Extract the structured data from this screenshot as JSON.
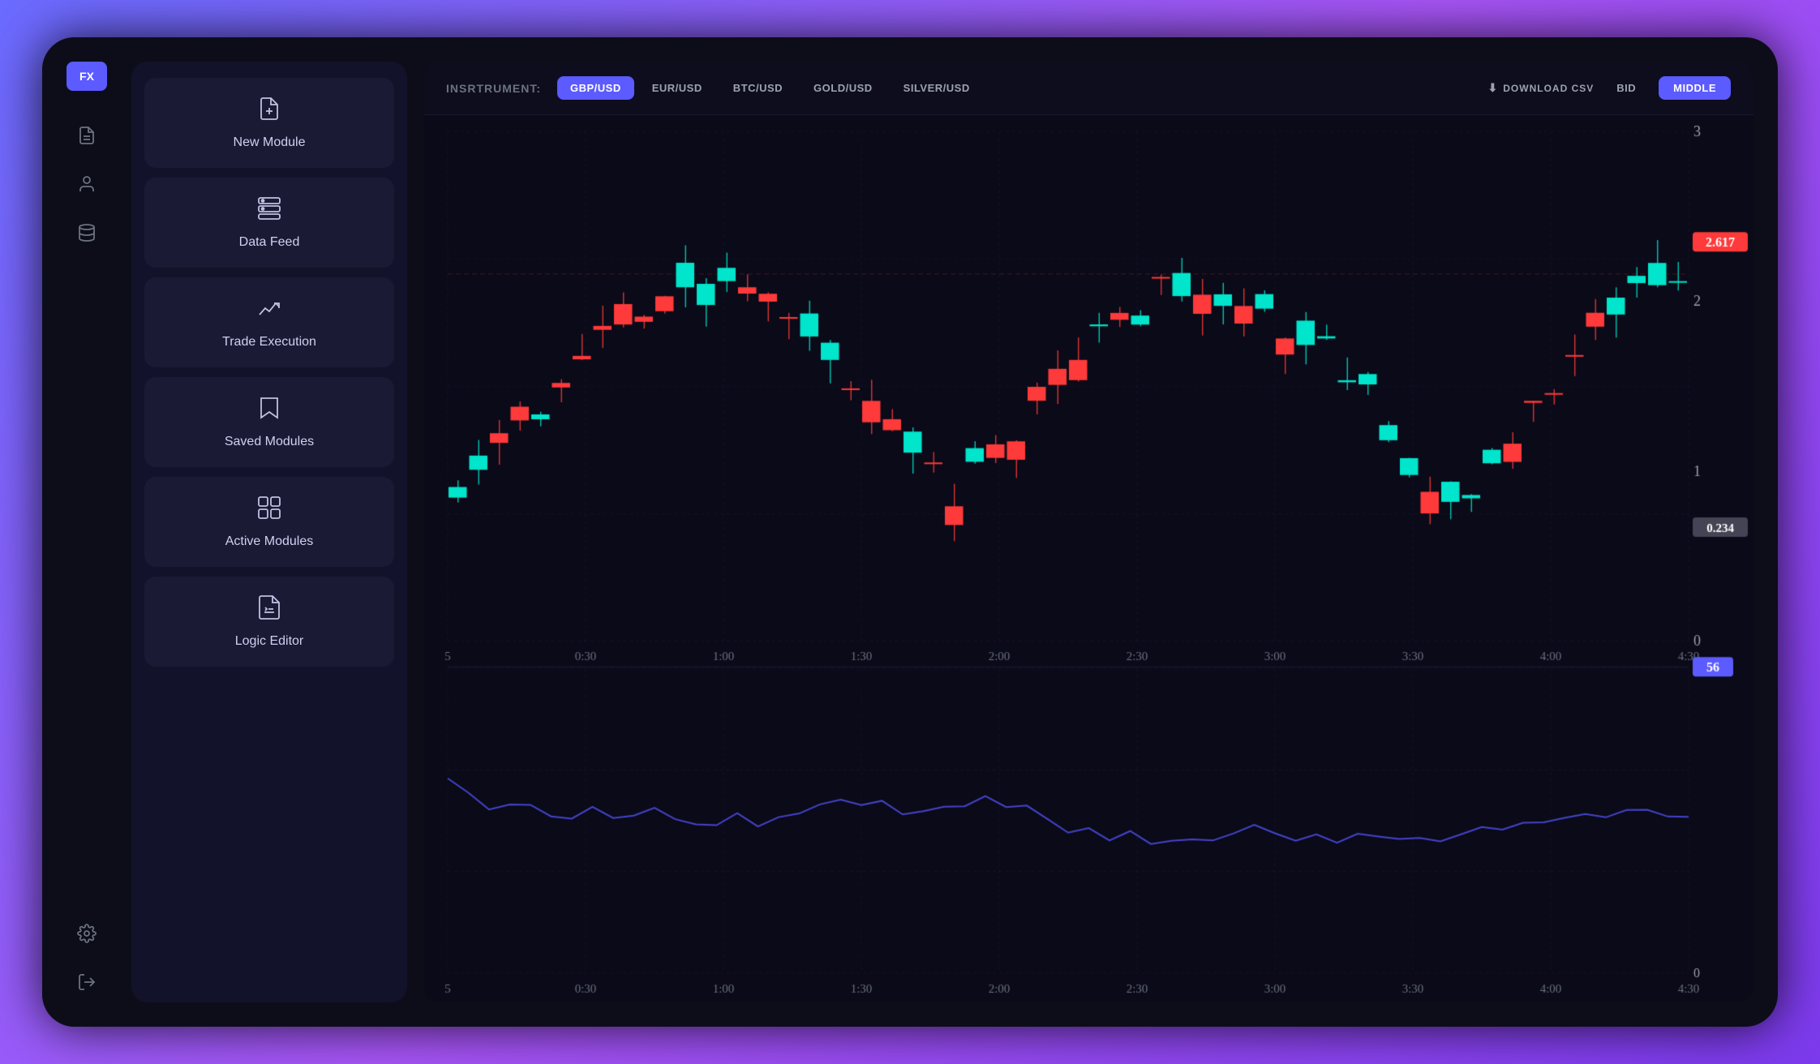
{
  "app": {
    "logo": "FX",
    "bg_color": "#0d0d1a"
  },
  "sidebar": {
    "icons": [
      {
        "name": "document-icon",
        "symbol": "📄",
        "active": false
      },
      {
        "name": "user-icon",
        "symbol": "👤",
        "active": false
      },
      {
        "name": "layers-icon",
        "symbol": "🗂",
        "active": false
      },
      {
        "name": "settings-icon",
        "symbol": "⚙",
        "active": false
      },
      {
        "name": "exit-icon",
        "symbol": "⬛",
        "active": false
      }
    ]
  },
  "left_menu": {
    "items": [
      {
        "id": "new-module",
        "label": "New Module",
        "icon": "file-plus"
      },
      {
        "id": "data-feed",
        "label": "Data Feed",
        "icon": "database"
      },
      {
        "id": "trade-execution",
        "label": "Trade Execution",
        "icon": "chart-line"
      },
      {
        "id": "saved-modules",
        "label": "Saved Modules",
        "icon": "bookmark"
      },
      {
        "id": "active-modules",
        "label": "Active Modules",
        "icon": "grid"
      },
      {
        "id": "logic-editor",
        "label": "Logic Editor",
        "icon": "edit"
      }
    ]
  },
  "instrument_bar": {
    "label": "INSRTRUMENT:",
    "tabs": [
      {
        "id": "gbp-usd",
        "label": "GBP/USD",
        "active": true
      },
      {
        "id": "eur-usd",
        "label": "EUR/USD",
        "active": false
      },
      {
        "id": "btc-usd",
        "label": "BTC/USD",
        "active": false
      },
      {
        "id": "gold-usd",
        "label": "GOLD/USD",
        "active": false
      },
      {
        "id": "silver-usd",
        "label": "SILVER/USD",
        "active": false
      }
    ],
    "download_csv": "DOWNLOAD CSV",
    "bid": "BID",
    "middle": "MIDDLE"
  },
  "chart": {
    "price_label_high": "2.617",
    "price_label_low": "0.234",
    "oscillator_label": "56",
    "x_axis_labels": [
      "5",
      "0:30",
      "1:00",
      "1:30",
      "2:00",
      "2:30",
      "3:00",
      "3:30",
      "4:00",
      "4:30"
    ],
    "y_axis_labels": [
      "3",
      "2",
      "1",
      "0"
    ],
    "colors": {
      "bullish": "#00e5cc",
      "bearish": "#ff3a3a",
      "oscillator_line": "#4040dd",
      "grid": "#1a1a2e",
      "price_label_high": "#ff3a3a",
      "price_label_low": "#555566"
    }
  }
}
